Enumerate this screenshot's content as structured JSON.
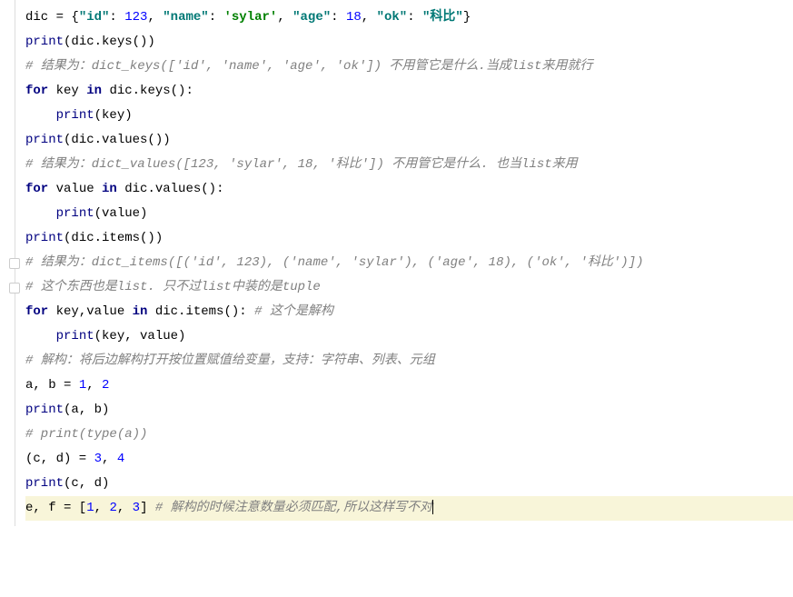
{
  "lines": [
    {
      "segments": [
        {
          "t": "dic = {",
          "c": "plain"
        },
        {
          "t": "\"id\"",
          "c": "str-key"
        },
        {
          "t": ": ",
          "c": "plain"
        },
        {
          "t": "123",
          "c": "num"
        },
        {
          "t": ", ",
          "c": "plain"
        },
        {
          "t": "\"name\"",
          "c": "str-key"
        },
        {
          "t": ": ",
          "c": "plain"
        },
        {
          "t": "'sylar'",
          "c": "str"
        },
        {
          "t": ", ",
          "c": "plain"
        },
        {
          "t": "\"age\"",
          "c": "str-key"
        },
        {
          "t": ": ",
          "c": "plain"
        },
        {
          "t": "18",
          "c": "num"
        },
        {
          "t": ", ",
          "c": "plain"
        },
        {
          "t": "\"ok\"",
          "c": "str-key"
        },
        {
          "t": ": ",
          "c": "plain"
        },
        {
          "t": "\"科比\"",
          "c": "str-key"
        },
        {
          "t": "}",
          "c": "plain"
        }
      ],
      "highlight": false
    },
    {
      "segments": [
        {
          "t": "print",
          "c": "builtin"
        },
        {
          "t": "(dic.keys())",
          "c": "plain"
        }
      ],
      "highlight": false
    },
    {
      "segments": [
        {
          "t": "# 结果为：dict_keys(['id', 'name', 'age', 'ok']) 不用管它是什么.当成list来用就行",
          "c": "comment"
        }
      ],
      "highlight": false
    },
    {
      "segments": [
        {
          "t": "for ",
          "c": "kw"
        },
        {
          "t": "key ",
          "c": "plain"
        },
        {
          "t": "in ",
          "c": "kw"
        },
        {
          "t": "dic.keys():",
          "c": "plain"
        }
      ],
      "highlight": false
    },
    {
      "segments": [
        {
          "t": "    ",
          "c": "plain"
        },
        {
          "t": "print",
          "c": "builtin"
        },
        {
          "t": "(key)",
          "c": "plain"
        }
      ],
      "highlight": false
    },
    {
      "segments": [
        {
          "t": "print",
          "c": "builtin"
        },
        {
          "t": "(dic.values())",
          "c": "plain"
        }
      ],
      "highlight": false
    },
    {
      "segments": [
        {
          "t": "# 结果为：dict_values([123, 'sylar', 18, '科比']) 不用管它是什么. 也当list来用",
          "c": "comment"
        }
      ],
      "highlight": false
    },
    {
      "segments": [
        {
          "t": "for ",
          "c": "kw"
        },
        {
          "t": "value ",
          "c": "plain"
        },
        {
          "t": "in ",
          "c": "kw"
        },
        {
          "t": "dic.values():",
          "c": "plain"
        }
      ],
      "highlight": false
    },
    {
      "segments": [
        {
          "t": "    ",
          "c": "plain"
        },
        {
          "t": "print",
          "c": "builtin"
        },
        {
          "t": "(value)",
          "c": "plain"
        }
      ],
      "highlight": false
    },
    {
      "segments": [
        {
          "t": "print",
          "c": "builtin"
        },
        {
          "t": "(dic.items())",
          "c": "plain"
        }
      ],
      "highlight": false
    },
    {
      "segments": [
        {
          "t": "# 结果为：dict_items([('id', 123), ('name', 'sylar'), ('age', 18), ('ok', '科比')])",
          "c": "comment"
        }
      ],
      "highlight": false,
      "fold": true
    },
    {
      "segments": [
        {
          "t": "# 这个东西也是list. 只不过list中装的是tuple",
          "c": "comment"
        }
      ],
      "highlight": false,
      "fold": true
    },
    {
      "segments": [
        {
          "t": "for ",
          "c": "kw"
        },
        {
          "t": "key,value ",
          "c": "plain"
        },
        {
          "t": "in ",
          "c": "kw"
        },
        {
          "t": "dic.items(): ",
          "c": "plain"
        },
        {
          "t": "# 这个是解构",
          "c": "comment"
        }
      ],
      "highlight": false
    },
    {
      "segments": [
        {
          "t": "    ",
          "c": "plain"
        },
        {
          "t": "print",
          "c": "builtin"
        },
        {
          "t": "(key, value)",
          "c": "plain"
        }
      ],
      "highlight": false
    },
    {
      "segments": [
        {
          "t": "# 解构：将后边解构打开按位置赋值给变量，支持：字符串、列表、元组",
          "c": "comment"
        }
      ],
      "highlight": false
    },
    {
      "segments": [
        {
          "t": "a, b = ",
          "c": "plain"
        },
        {
          "t": "1",
          "c": "num"
        },
        {
          "t": ", ",
          "c": "plain"
        },
        {
          "t": "2",
          "c": "num"
        }
      ],
      "highlight": false
    },
    {
      "segments": [
        {
          "t": "print",
          "c": "builtin"
        },
        {
          "t": "(a, b)",
          "c": "plain"
        }
      ],
      "highlight": false
    },
    {
      "segments": [
        {
          "t": "# print(type(a))",
          "c": "comment"
        }
      ],
      "highlight": false
    },
    {
      "segments": [
        {
          "t": "(c, d) = ",
          "c": "plain"
        },
        {
          "t": "3",
          "c": "num"
        },
        {
          "t": ", ",
          "c": "plain"
        },
        {
          "t": "4",
          "c": "num"
        }
      ],
      "highlight": false
    },
    {
      "segments": [
        {
          "t": "print",
          "c": "builtin"
        },
        {
          "t": "(c, d)",
          "c": "plain"
        }
      ],
      "highlight": false
    },
    {
      "segments": [
        {
          "t": "e, f = [",
          "c": "plain"
        },
        {
          "t": "1",
          "c": "num"
        },
        {
          "t": ", ",
          "c": "plain"
        },
        {
          "t": "2",
          "c": "num"
        },
        {
          "t": ", ",
          "c": "plain"
        },
        {
          "t": "3",
          "c": "num"
        },
        {
          "t": "] ",
          "c": "plain"
        },
        {
          "t": "# 解构的时候注意数量必须匹配,所以这样写不对",
          "c": "comment"
        }
      ],
      "highlight": true,
      "caret": true
    }
  ]
}
